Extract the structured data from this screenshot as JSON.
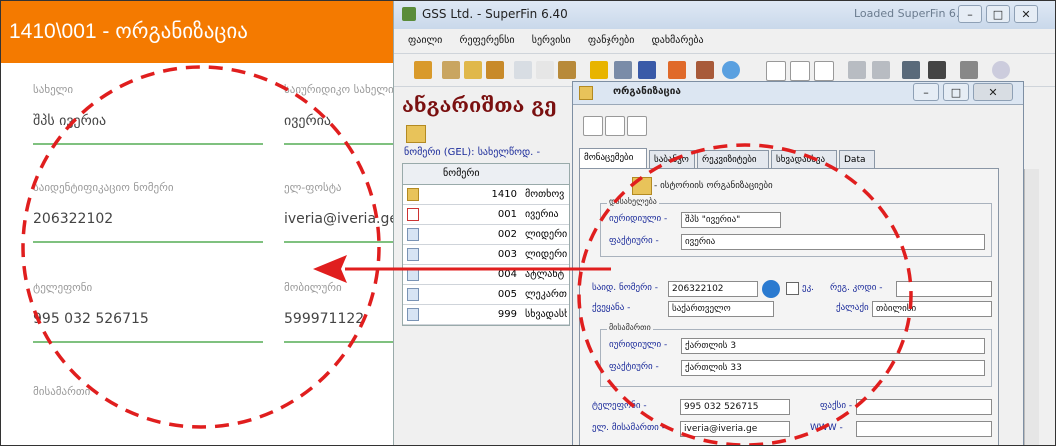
{
  "mobile": {
    "header_title": "1410\\001 - ორგანიზაცია",
    "fields": {
      "name": {
        "label": "სახელი",
        "value": "შპს ივერია"
      },
      "legal_name": {
        "label": "საიურიდიკო სახელი",
        "value": "ივერია"
      },
      "id_code": {
        "label": "საიდენტიფიკაციო ნომერი",
        "value": "206322102"
      },
      "email": {
        "label": "ელ-ფოსტა",
        "value": "iveria@iveria.ge"
      },
      "phone": {
        "label": "ტელეფონი",
        "value": "995 032 526715"
      },
      "mobile": {
        "label": "მობილური",
        "value": "599971122"
      },
      "address": {
        "label": "მისამართი"
      }
    }
  },
  "desktop": {
    "window_title": "GSS Ltd. - SuperFin 6.40",
    "ghost_title": "Loaded SuperFin 6.40",
    "menu": [
      "ფაილი",
      "რეფერენსი",
      "სერვისი",
      "ფანჯრები",
      "დახმარება"
    ],
    "big_title": "ანგარიშთა გე",
    "currency_line": "ნომერი (GEL):  სახელწოდ. -",
    "grid": {
      "header": "ნომერი",
      "rows": [
        {
          "num": "1410",
          "name": "მოთხოვ"
        },
        {
          "num": "001",
          "name": "ივერია"
        },
        {
          "num": "002",
          "name": "ლიდერი"
        },
        {
          "num": "003",
          "name": "ლიდერი"
        },
        {
          "num": "004",
          "name": "ატლანტ"
        },
        {
          "num": "005",
          "name": "ლეკართ"
        },
        {
          "num": "999",
          "name": "სხვადასხვ"
        }
      ]
    }
  },
  "dialog": {
    "title": "ორგანიზაცია",
    "tabs": [
      "მონაცემები",
      "საბანკო",
      "რეკვიზიტები",
      "სხვადასხვა",
      "Data"
    ],
    "group_label_text": "- ისტორიის ორგანიზაციები",
    "name_group": {
      "title": "დასახელება",
      "legal_label": "იურიდიული -",
      "legal_value": "შპს \"ივერია\"",
      "actual_label": "ფაქტიური -",
      "actual_value": "ივერია"
    },
    "tax_label": "საიდ. ნომერი -",
    "tax_value": "206322102",
    "vat_label": "ეკ.",
    "region_label": "რეგ. კოდი -",
    "country_label": "ქვეყანა -",
    "country_value": "საქართველო",
    "city_label": "ქალაქი -",
    "city_value": "თბილისი",
    "address_group": {
      "title": "მისამართი",
      "legal_label": "იურიდიული -",
      "legal_value": "ქართლის 3",
      "actual_label": "ფაქტიური -",
      "actual_value": "ქართლის 33"
    },
    "phone_label": "ტელეფონი -",
    "phone_value": "995 032 526715",
    "fax_label": "ფაქსი -",
    "email_label": "ელ. მისამართი -",
    "email_value": "iveria@iveria.ge",
    "www_label": "WWW -"
  },
  "colors": {
    "header_orange": "#f47a00",
    "underline_green": "#7fc17f",
    "annotation_red": "#e01e1e"
  }
}
